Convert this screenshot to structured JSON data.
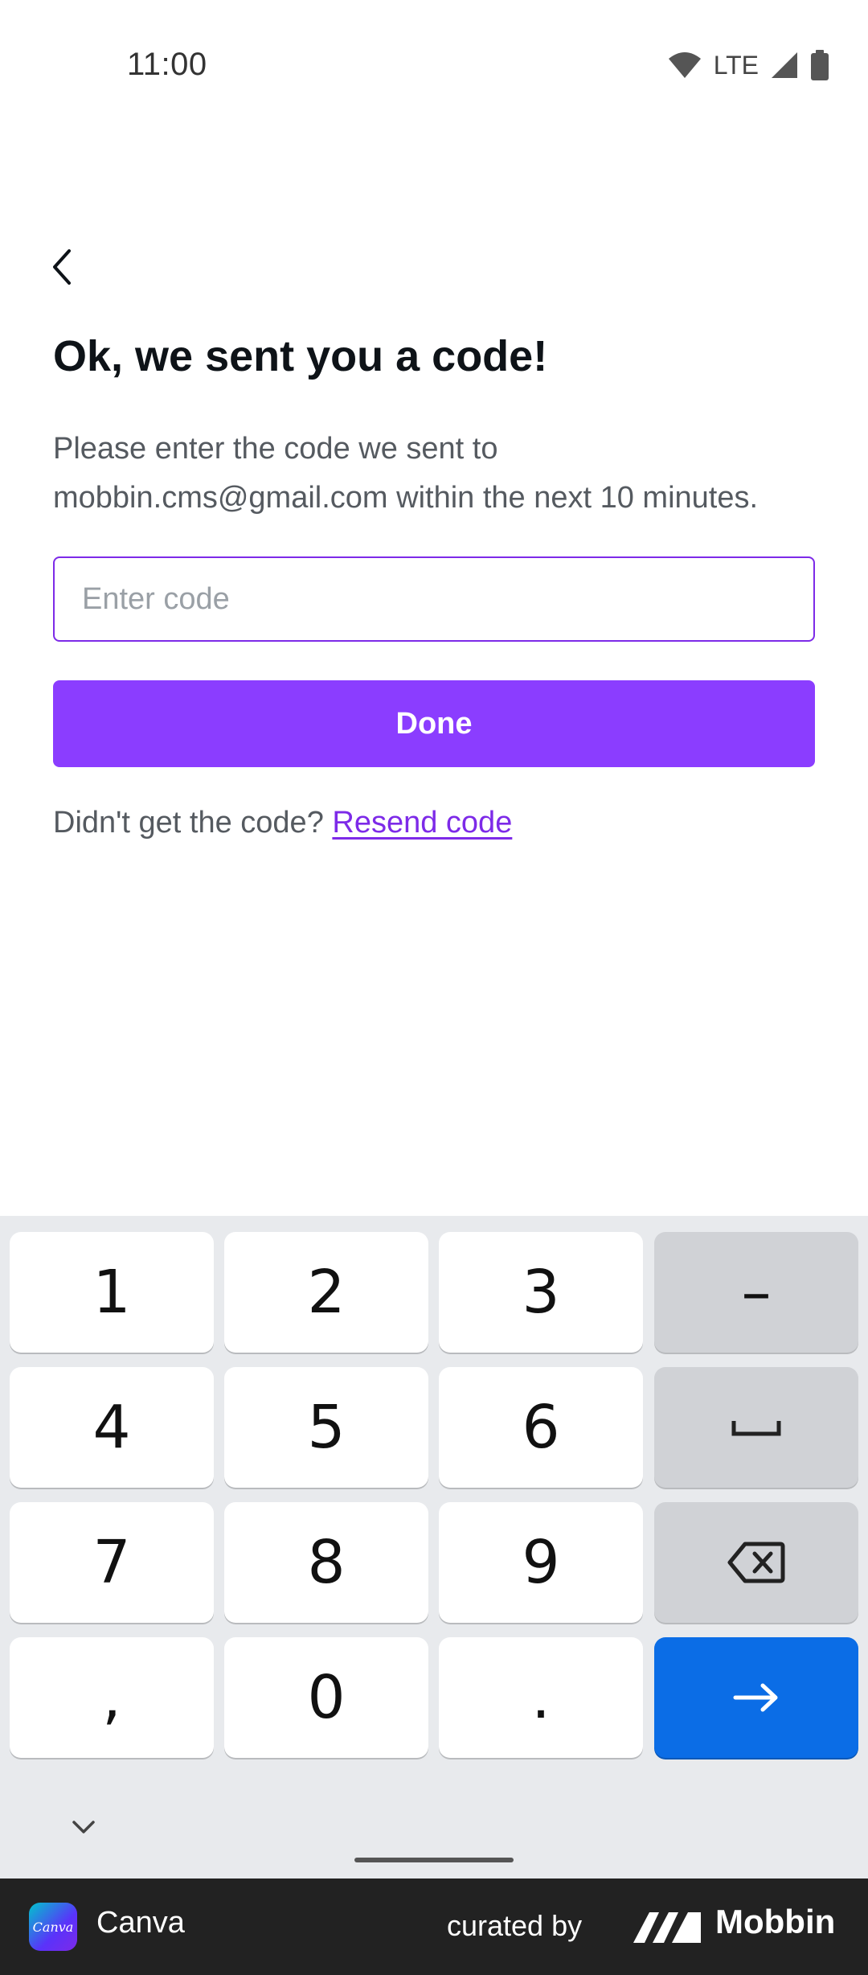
{
  "status_bar": {
    "time": "11:00",
    "network": "LTE"
  },
  "screen": {
    "title": "Ok, we sent you a code!",
    "description": "Please enter the code we sent to mobbin.cms@gmail.com within the next 10 minutes.",
    "code_input": {
      "placeholder": "Enter code",
      "value": ""
    },
    "done_label": "Done",
    "resend_prompt": "Didn't get the code?",
    "resend_link": "Resend code",
    "accent_color": "#8b3dff"
  },
  "keyboard": {
    "rows": [
      [
        "1",
        "2",
        "3",
        "–"
      ],
      [
        "4",
        "5",
        "6",
        "space-icon"
      ],
      [
        "7",
        "8",
        "9",
        "backspace-icon"
      ],
      [
        ",",
        "0",
        ".",
        "enter-arrow-icon"
      ]
    ],
    "enter_color": "#0b6de6"
  },
  "banner": {
    "app_name": "Canva",
    "app_logo_text": "Canva",
    "curated_by": "curated by",
    "brand": "Mobbin"
  }
}
